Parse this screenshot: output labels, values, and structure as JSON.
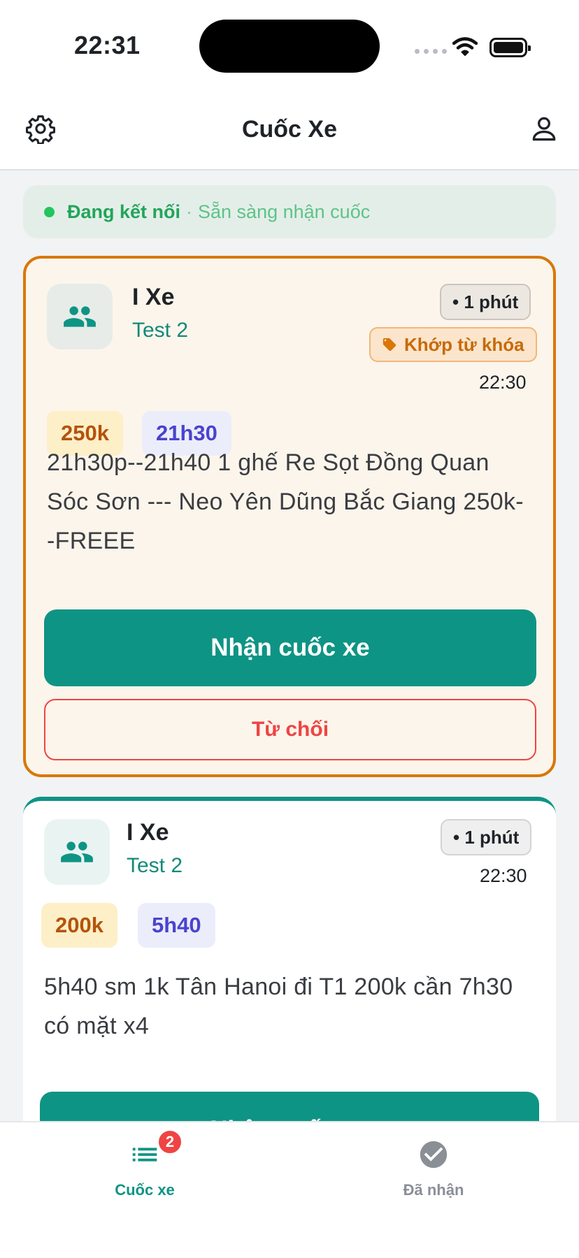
{
  "status_bar": {
    "time": "22:31"
  },
  "header": {
    "title": "Cuốc Xe"
  },
  "connection": {
    "status": "Đang kết nối",
    "separator": "·",
    "message": "Sẵn sàng nhận cuốc"
  },
  "rides": [
    {
      "name": "I Xe",
      "group": "Test 2",
      "age": "• 1 phút",
      "keyword_badge": "Khớp từ khóa",
      "time": "22:30",
      "price": "250k",
      "pickup_time": "21h30",
      "message": "21h30p--21h40  1 ghế Re Sọt Đồng Quan Sóc Sơn --- Neo  Yên Dũng Bắc Giang 250k--FREEE",
      "accept_label": "Nhận cuốc xe",
      "reject_label": "Từ chối",
      "highlight_color": "#d97706"
    },
    {
      "name": "I Xe",
      "group": "Test 2",
      "age": "• 1 phút",
      "time": "22:30",
      "price": "200k",
      "pickup_time": "5h40",
      "message": "5h40 sm 1k Tân  Hanoi đi T1 200k cần 7h30 có mặt x4",
      "accept_label": "Nhận cuốc xe",
      "highlight_color": "#0e9484"
    }
  ],
  "tabs": [
    {
      "label": "Cuốc xe",
      "icon": "list-icon",
      "badge": "2",
      "active": true
    },
    {
      "label": "Đã nhận",
      "icon": "check-circle-icon",
      "active": false
    }
  ],
  "colors": {
    "primary": "#0e9484",
    "accent": "#d97706",
    "danger": "#ef4444",
    "connected": "#22c55e"
  }
}
